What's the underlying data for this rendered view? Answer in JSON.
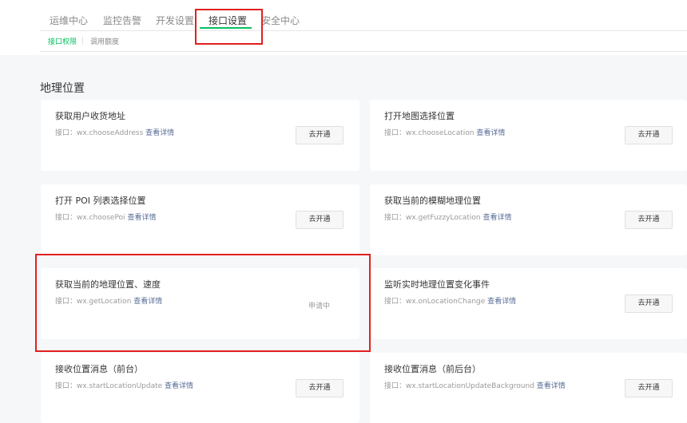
{
  "nav": {
    "tabs": [
      {
        "label": "运维中心"
      },
      {
        "label": "监控告警"
      },
      {
        "label": "开发设置"
      },
      {
        "label": "接口设置"
      },
      {
        "label": "安全中心"
      }
    ],
    "active_tab": "接口设置",
    "subtabs": [
      {
        "label": "接口权限"
      },
      {
        "label": "调用额度"
      }
    ],
    "active_subtab": "接口权限"
  },
  "section": {
    "title": "地理位置"
  },
  "cards": [
    {
      "title": "获取用户收货地址",
      "desc_prefix": "接口：wx.chooseAddress",
      "link": "查看详情",
      "action": "去开通",
      "action_type": "button"
    },
    {
      "title": "打开地图选择位置",
      "desc_prefix": "接口：wx.chooseLocation",
      "link": "查看详情",
      "action": "去开通",
      "action_type": "button"
    },
    {
      "title": "打开 POI 列表选择位置",
      "desc_prefix": "接口：wx.choosePoi",
      "link": "查看详情",
      "action": "去开通",
      "action_type": "button"
    },
    {
      "title": "获取当前的模糊地理位置",
      "desc_prefix": "接口：wx.getFuzzyLocation",
      "link": "查看详情",
      "action": "去开通",
      "action_type": "button"
    },
    {
      "title": "获取当前的地理位置、速度",
      "desc_prefix": "接口：wx.getLocation",
      "link": "查看详情",
      "action": "申请中",
      "action_type": "status"
    },
    {
      "title": "监听实时地理位置变化事件",
      "desc_prefix": "接口：wx.onLocationChange",
      "link": "查看详情",
      "action": "去开通",
      "action_type": "button"
    },
    {
      "title": "接收位置消息（前台）",
      "desc_prefix": "接口：wx.startLocationUpdate",
      "link": "查看详情",
      "action": "去开通",
      "action_type": "button"
    },
    {
      "title": "接收位置消息（前后台）",
      "desc_prefix": "接口：wx.startLocationUpdateBackground",
      "link": "查看详情",
      "action": "去开通",
      "action_type": "button"
    }
  ],
  "colors": {
    "accent": "#07c160",
    "link": "#576b95",
    "highlight": "#e02020",
    "background": "#f6f7f9"
  }
}
